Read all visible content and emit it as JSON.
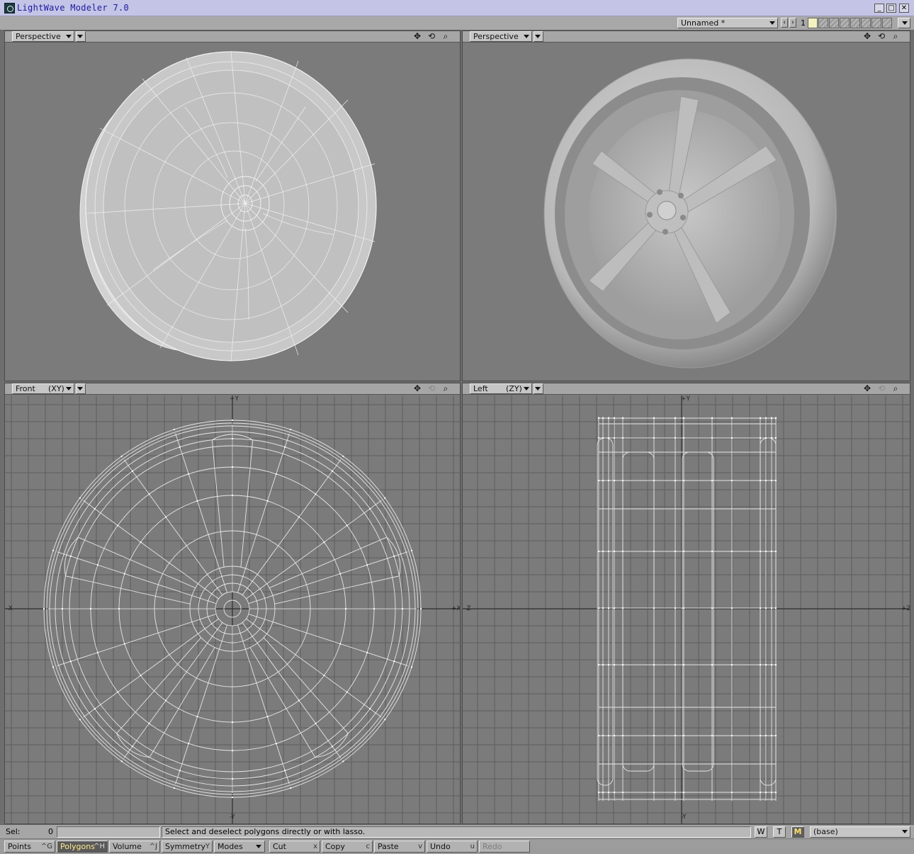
{
  "window": {
    "title": "LightWave Modeler 7.0",
    "minimize": "_",
    "maximize": "□",
    "close": "✕"
  },
  "toolbar": {
    "object_name": "Unnamed *",
    "layer_prev": "‹",
    "layer_next": "›",
    "layer_number": "1"
  },
  "viewports": [
    {
      "id": "top-left",
      "view": "Perspective",
      "axis": "",
      "mode": "wireframe-shaded"
    },
    {
      "id": "top-right",
      "view": "Perspective",
      "axis": "",
      "mode": "smooth-shaded"
    },
    {
      "id": "bottom-left",
      "view": "Front",
      "axis": "(XY)",
      "mode": "wireframe",
      "axis_labels": {
        "top": "+Y",
        "bottom": "-Y",
        "left": "-X",
        "right": "+X"
      }
    },
    {
      "id": "bottom-right",
      "view": "Left",
      "axis": "(ZY)",
      "mode": "wireframe",
      "axis_labels": {
        "top": "+Y",
        "bottom": "-Y",
        "left": "-Z",
        "right": "+Z"
      }
    }
  ],
  "viewport_controls": {
    "move_icon": "pan-icon",
    "rotate_icon": "rotate-icon",
    "zoom_icon": "zoom-icon"
  },
  "status": {
    "sel_label": "Sel:",
    "sel_value": "0",
    "message": "Select and deselect polygons directly or with lasso.",
    "w_label": "W",
    "t_label": "T",
    "m_label": "M",
    "surface": "(base)"
  },
  "commands": [
    {
      "label": "Points",
      "key": "^G",
      "state": "normal"
    },
    {
      "label": "Polygons",
      "key": "^H",
      "state": "active"
    },
    {
      "label": "Volume",
      "key": "^J",
      "state": "normal"
    },
    {
      "label": "Symmetry",
      "key": "Y",
      "state": "normal"
    },
    {
      "label": "Modes",
      "key": "",
      "state": "dropdown"
    },
    {
      "label": "Cut",
      "key": "x",
      "state": "normal"
    },
    {
      "label": "Copy",
      "key": "c",
      "state": "normal"
    },
    {
      "label": "Paste",
      "key": "v",
      "state": "normal"
    },
    {
      "label": "Undo",
      "key": "u",
      "state": "normal"
    },
    {
      "label": "Redo",
      "key": "",
      "state": "disabled"
    }
  ],
  "colors": {
    "viewport_bg": "#7b7b7b",
    "grid_line": "#5e5e5e",
    "wire": "#e6e6e6",
    "title_text": "#1a1aa0",
    "active_mode": "#ffe070"
  }
}
